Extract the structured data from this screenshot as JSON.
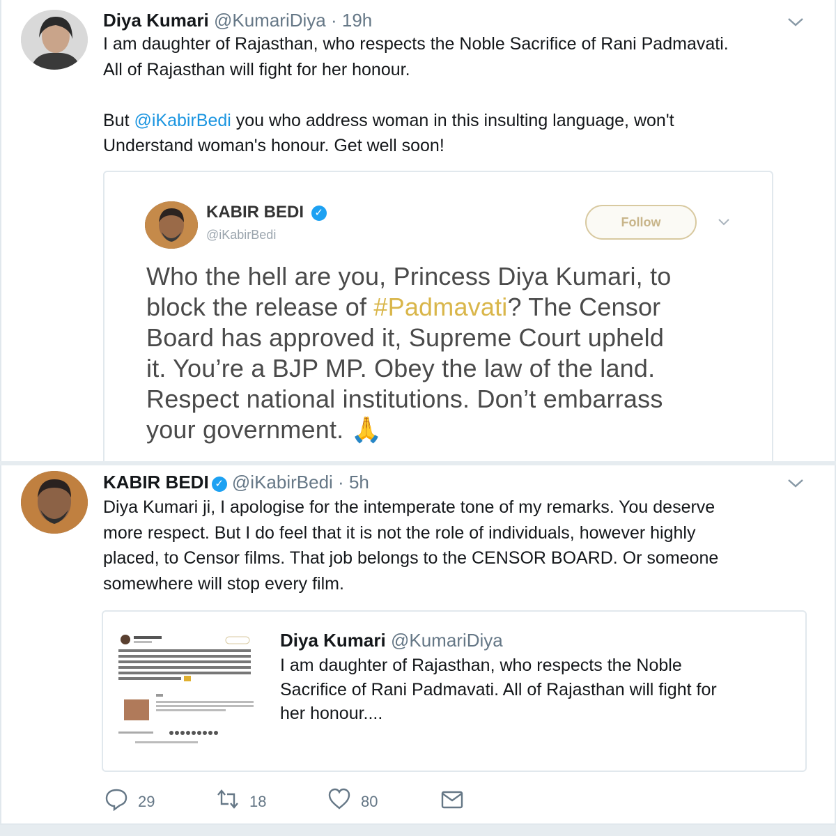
{
  "tweet1": {
    "author_name": "Diya Kumari",
    "handle": "@KumariDiya",
    "separator": "·",
    "time": "19h",
    "text_line1": "I am daughter of Rajasthan, who respects the Noble Sacrifice of Rani Padmavati.",
    "text_line2": "All of Rajasthan will fight for her honour.",
    "mention": "@iKabirBedi",
    "text_line3_before": "But ",
    "text_line3_after": " you who address woman in this insulting language, won't",
    "text_line4": "Understand woman's honour. Get well soon!",
    "quoted_screenshot": {
      "author_name": "KABIR BEDI",
      "handle": "@iKabirBedi",
      "follow_label": "Follow",
      "line1": "Who the hell are you, Princess Diya Kumari, to",
      "line2_before": "block the release of ",
      "hashtag": "#Padmavati",
      "line2_after": "? The Censor",
      "line3": "Board has approved it, Supreme Court upheld",
      "line4": "it. You’re a BJP MP. Obey the law of the land.",
      "line5": "Respect national institutions. Don’t embarrass",
      "line6": "your government.",
      "emoji": "🙏"
    }
  },
  "tweet2": {
    "author_name": "KABIR BEDI",
    "handle": "@iKabirBedi",
    "separator": "·",
    "time": "5h",
    "text_line1": "Diya Kumari ji, I apologise for the intemperate tone of my remarks. You deserve",
    "text_line2": "more respect. But I do feel that it is not the role of individuals, however highly",
    "text_line3": "placed, to Censor films. That job belongs to the CENSOR BOARD. Or someone",
    "text_line4": "somewhere will stop every film.",
    "quoted": {
      "author_name": "Diya Kumari",
      "handle": "@KumariDiya",
      "line1": "I am daughter of Rajasthan, who respects the Noble",
      "line2": "Sacrifice of Rani Padmavati. All of Rajasthan will fight for",
      "line3": "her honour...."
    },
    "actions": {
      "replies": "29",
      "retweets": "18",
      "likes": "80"
    }
  },
  "colors": {
    "link": "#1b95e0",
    "verified": "#1da1f2",
    "muted": "#657786",
    "hashtag_in_screenshot": "#d9b64a"
  },
  "icons": [
    "chevron-down-icon",
    "verified-badge-icon",
    "reply-icon",
    "retweet-icon",
    "like-icon",
    "direct-message-icon"
  ]
}
